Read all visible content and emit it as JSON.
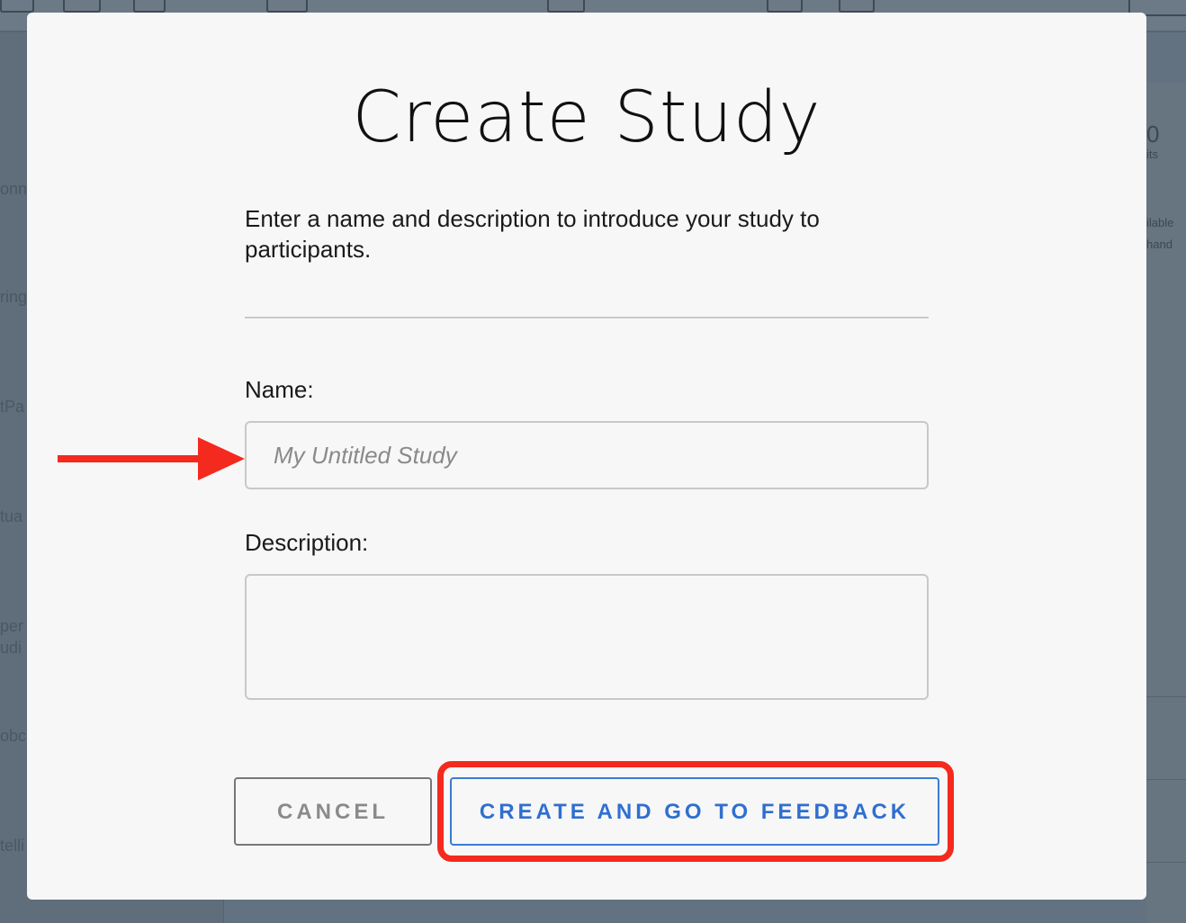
{
  "background": {
    "side_items": [
      "onn",
      "ring",
      "tPa",
      "tua",
      "per",
      "udi",
      "obc",
      "telli"
    ],
    "right_panel": {
      "count": "0",
      "count_label": "its",
      "line1": "ilable",
      "line2": "hand"
    }
  },
  "modal": {
    "title": "Create Study",
    "intro": "Enter a name and description to introduce your study to participants.",
    "name_label": "Name:",
    "name_placeholder": "My Untitled Study",
    "name_value": "",
    "description_label": "Description:",
    "description_value": "",
    "cancel_label": "CANCEL",
    "create_label": "CREATE AND GO TO FEEDBACK"
  },
  "annotations": {
    "arrow_color": "#f42a1e",
    "highlight_color": "#f42a1e"
  },
  "colors": {
    "accent": "#2f6fd0",
    "overlay": "#637280"
  }
}
